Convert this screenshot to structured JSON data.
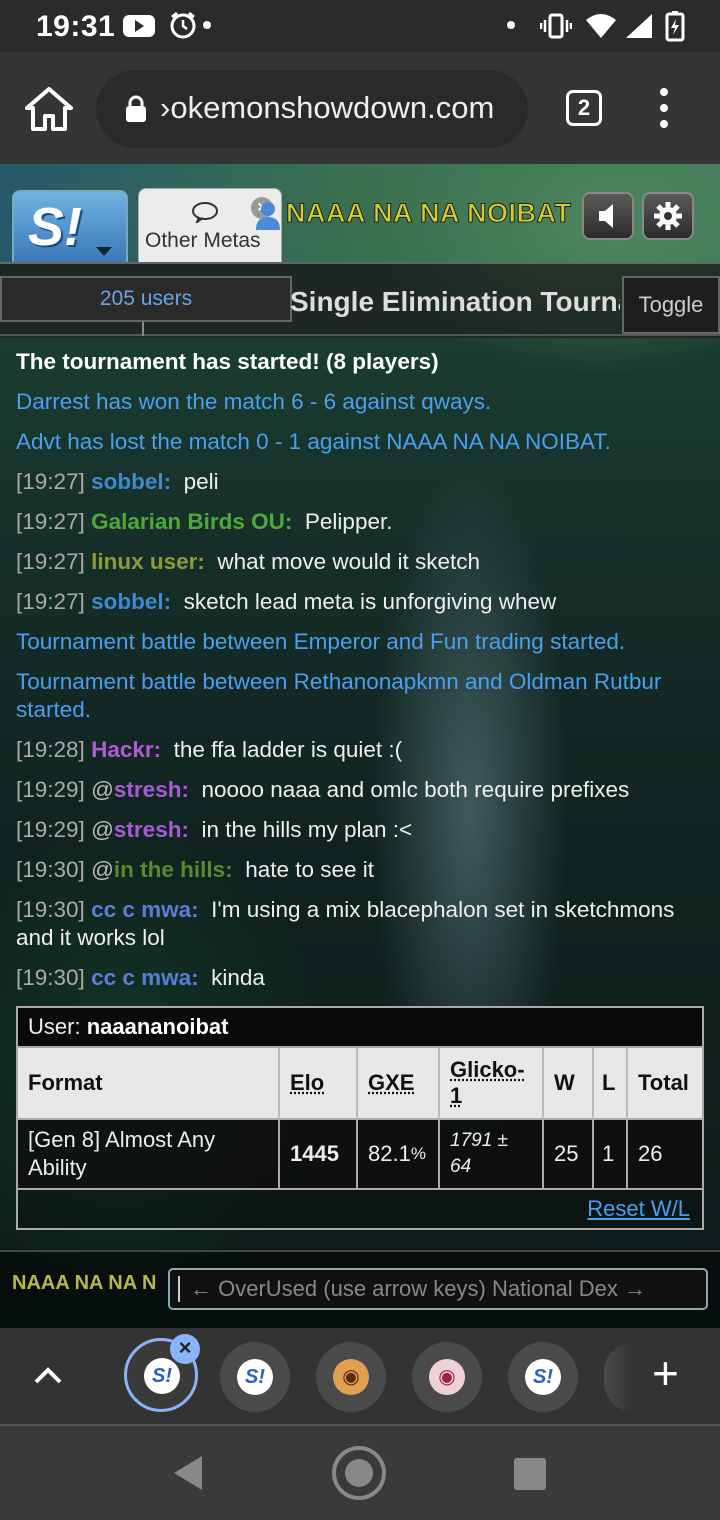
{
  "status": {
    "time": "19:31"
  },
  "browser": {
    "url": "›okemonshowdown.com",
    "tab_count": "2"
  },
  "header": {
    "room_tab": "Other Metas",
    "username": "NAAA NA NA NOIBAT"
  },
  "roombar": {
    "users": "205 users",
    "title": "Single Elimination Tournament",
    "toggle": "Toggle"
  },
  "chat": {
    "started": "The tournament has started! (8 players)",
    "won": "Darrest has won the match 6 - 6 against qways.",
    "lost": "Advt has lost the match 0 - 1 against NAAA NA NA NOIBAT.",
    "m1": {
      "ts": "[19:27]",
      "nick": "sobbel:",
      "text": "peli"
    },
    "m2": {
      "ts": "[19:27]",
      "nick": "Galarian Birds OU:",
      "text": "Pelipper."
    },
    "m3": {
      "ts": "[19:27]",
      "nick": "linux user:",
      "text": "what move would it sketch"
    },
    "m4": {
      "ts": "[19:27]",
      "nick": "sobbel:",
      "text": "sketch lead meta is unforgiving whew"
    },
    "battle1": "Tournament battle between Emperor and Fun trading started.",
    "battle2": "Tournament battle between Rethanonapkmn and Oldman Rutbur started.",
    "m5": {
      "ts": "[19:28]",
      "nick": "Hackr:",
      "text": "the ffa ladder is quiet :("
    },
    "m6": {
      "ts": "[19:29]",
      "at": "@",
      "nick": "stresh:",
      "text": "noooo naaa and omlc both require prefixes"
    },
    "m7": {
      "ts": "[19:29]",
      "at": "@",
      "nick": "stresh:",
      "text": "in the hills my plan :<"
    },
    "m8": {
      "ts": "[19:30]",
      "at": "@",
      "nick": "in the hills:",
      "text": "hate to see it"
    },
    "m9": {
      "ts": "[19:30]",
      "nick": "cc c mwa:",
      "text": "I'm using a mix blacephalon set in sketchmons and it works lol"
    },
    "m10": {
      "ts": "[19:30]",
      "nick": "cc c mwa:",
      "text": "kinda"
    }
  },
  "rank": {
    "user_label": "User:",
    "user": "naaananoibat",
    "headers": {
      "format": "Format",
      "elo": "Elo",
      "gxe": "GXE",
      "glicko": "Glicko-1",
      "w": "W",
      "l": "L",
      "total": "Total"
    },
    "row": {
      "format": "[Gen 8] Almost Any Ability",
      "elo": "1445",
      "gxe": "82.1",
      "gxe_unit": "%",
      "glicko": "1791 ± 64",
      "w": "25",
      "l": "1",
      "total": "26"
    },
    "reset": "Reset W/L"
  },
  "input": {
    "name": "NAAA NA NA N",
    "placeholder": "← OverUsed (use arrow keys) National Dex →"
  },
  "colors": {
    "notice": "#4a9ff0",
    "sobbel": "#3d8ad1",
    "galarian": "#4ea83a",
    "linux": "#8e9a3a",
    "hackr": "#b15ad6",
    "stresh": "#a95ad8",
    "hills": "#5a8a2c",
    "ccc": "#5a7ed8"
  }
}
